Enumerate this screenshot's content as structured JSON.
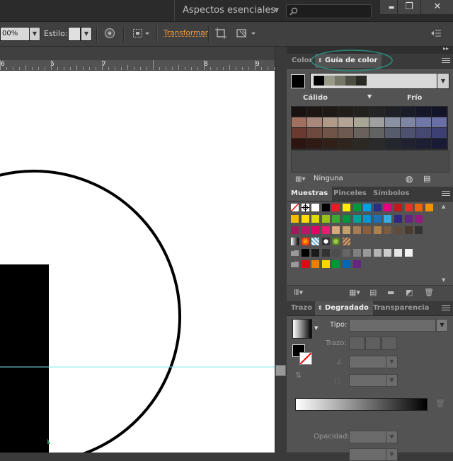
{
  "titlebar": {
    "workspace_label": "Aspectos esenciales",
    "minimize_glyph": "▬",
    "restore_glyph": "❐",
    "close_glyph": "✕"
  },
  "controlbar": {
    "zoom_value": "00%",
    "style_label": "Estilo:",
    "transform_label": "Transformar"
  },
  "ruler": {
    "labels": [
      "6",
      "5",
      "7",
      "8",
      "9"
    ]
  },
  "color_panel": {
    "tabs": [
      "Color",
      "Guía de color"
    ],
    "warm_label": "Cálido",
    "cold_label": "Frío",
    "none_label": "Ninguna",
    "harmony_colors": [
      "#000000",
      "#9a9a88",
      "#777768",
      "#4d4d44",
      "#2a2a25"
    ],
    "guide_rows": [
      [
        "#1a1210",
        "#1e1612",
        "#201a16",
        "#221e1a",
        "#24221e",
        "#242424",
        "#1e2026",
        "#1a1c28",
        "#16182a",
        "#12142a"
      ],
      [
        "#a07060",
        "#a8887a",
        "#b09a8a",
        "#b4a496",
        "#aaa696",
        "#a0a0a0",
        "#8a92a4",
        "#7e86a4",
        "#7078a8",
        "#6a70a6"
      ],
      [
        "#6a3a30",
        "#6e4a3e",
        "#705448",
        "#6e5a50",
        "#68625a",
        "#626262",
        "#565c6c",
        "#4c5270",
        "#444872",
        "#3c4072"
      ],
      [
        "#2e1410",
        "#301a14",
        "#302018",
        "#30241e",
        "#2c2822",
        "#2a2a2a",
        "#24262e",
        "#202232",
        "#1c1e34",
        "#181a36"
      ]
    ]
  },
  "swatches_panel": {
    "tabs": [
      "Muestras",
      "Pinceles",
      "Símbolos"
    ],
    "rows": [
      [
        "none",
        "reg",
        "#ffffff",
        "#000000",
        "#e31e24",
        "#ffed00",
        "#00963f",
        "#00a0e3",
        "#2d2e83",
        "#e5007d",
        "#c5161d",
        "#e6332a",
        "#ec6608",
        "#f39200"
      ],
      [
        "#fbba00",
        "#ffde00",
        "#dedc00",
        "#95c11f",
        "#3aaa35",
        "#009640",
        "#00a19a",
        "#0096d6",
        "#1d71b8",
        "#36a9e1",
        "#312783",
        "#662483",
        "#951b81"
      ],
      [
        "#a3195b",
        "#c0136b",
        "#e50068",
        "#e71d73",
        "#d8aa79",
        "#c6a16b",
        "#a67c52",
        "#8b5e3c",
        "#b17f4a",
        "#7b5c3e",
        "#604a39",
        "#4c3a2b",
        "#333333"
      ],
      [
        "grad1",
        "grad2",
        "pat1",
        "pat2",
        "pat3",
        "pat4"
      ],
      [
        "folder",
        "#000000",
        "#1a1a1a",
        "#333333",
        "#4d4d4d",
        "#666666",
        "#808080",
        "#999999",
        "#b3b3b3",
        "#cccccc",
        "#e6e6e6",
        "#f2f2f2"
      ],
      [
        "folder",
        "#e30613",
        "#ef7d00",
        "#ffd500",
        "#009640",
        "#0069b4",
        "#662483"
      ]
    ]
  },
  "gradient_panel": {
    "tabs": [
      "Trazo",
      "Degradado",
      "Transparencia"
    ],
    "type_label": "Tipo:",
    "stroke_label": "Trazo:",
    "opacity_label": "Opacidad:"
  }
}
